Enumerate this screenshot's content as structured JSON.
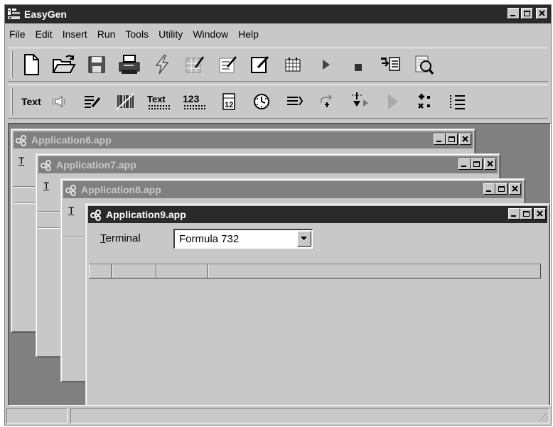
{
  "app": {
    "title": "EasyGen",
    "title_bar_color": "#2a2a2a"
  },
  "menu": [
    "File",
    "Edit",
    "Insert",
    "Run",
    "Tools",
    "Utility",
    "Window",
    "Help"
  ],
  "toolbar1": {
    "icons": [
      "new-document-icon",
      "open-folder-icon",
      "save-disk-icon",
      "print-icon",
      "lightning-icon",
      "table-edit-icon",
      "checklist-edit-icon",
      "pencil-box-icon",
      "calendar-grid-icon",
      "play-icon",
      "stop-icon",
      "insert-list-icon",
      "find-replace-icon"
    ]
  },
  "toolbar2": {
    "text_button": "Text",
    "text_format_button": "Text",
    "numbers_button": "123",
    "calendar_number": "12",
    "icons": [
      "speaker-icon",
      "list-edit-icon",
      "barcode-icon",
      "text-format-icon",
      "number-format-icon",
      "calendar-icon",
      "clock-icon",
      "list-arrow-icon",
      "loop-icon",
      "step-down-icon",
      "run-triangle-icon",
      "multiply-list-icon",
      "bulleted-list-icon"
    ]
  },
  "windows": [
    {
      "title": "Application6.app",
      "peek_label": "T",
      "active": false
    },
    {
      "title": "Application7.app",
      "peek_label": "T",
      "active": false
    },
    {
      "title": "Application8.app",
      "peek_label": "T",
      "active": false
    },
    {
      "title": "Application9.app",
      "active": true,
      "field_label_accel": "T",
      "field_label_rest": "erminal",
      "combo_value": "Formula 732"
    }
  ]
}
